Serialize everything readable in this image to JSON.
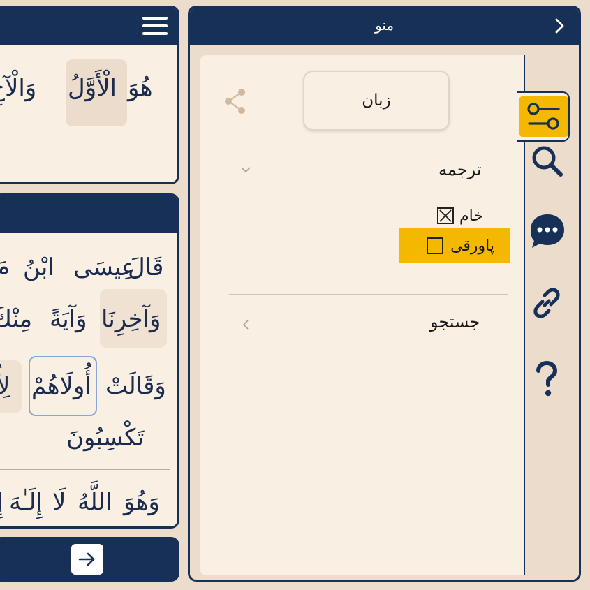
{
  "reader": {
    "top_panel": {
      "words": [
        "هُوَ",
        "الْأَوَّلُ",
        "وَالْآخِ"
      ]
    },
    "middle_panel": {
      "lines": [
        [
          "قَالَ",
          "عِيسَى",
          "ابْنُ",
          "مَ"
        ],
        [
          "وَآخِرِنَا",
          "وَآيَةً",
          "مِنْكَ"
        ],
        [
          "وَقَالَتْ",
          "أُولَاهُمْ",
          "لِأُ"
        ],
        [
          "تَكْسِبُونَ"
        ],
        [
          "وَهُوَ",
          "اللَّهُ",
          "لَا",
          "إِلَـٰهَ",
          "إِ"
        ]
      ]
    },
    "next_icon": "arrow-right-icon"
  },
  "menu": {
    "title": "منو",
    "back_icon": "chevron-right-icon",
    "language_button": "زبان",
    "share_icon": "share-icon",
    "translation": {
      "title": "ترجمه",
      "expanded": true,
      "options": [
        {
          "label": "خام",
          "checked": true,
          "highlighted": false
        },
        {
          "label": "پاورقی",
          "checked": false,
          "highlighted": true
        }
      ]
    },
    "search": {
      "title": "جستجو",
      "expanded": false
    },
    "rail": [
      {
        "name": "filter-icon",
        "active": true
      },
      {
        "name": "search-icon",
        "active": false
      },
      {
        "name": "chat-bubble-icon",
        "active": false
      },
      {
        "name": "link-icon",
        "active": false
      },
      {
        "name": "help-icon",
        "active": false
      }
    ]
  },
  "colors": {
    "navy": "#163058",
    "background": "#ecdccb",
    "panel": "#f9efe3",
    "accent_yellow": "#f5b800",
    "text": "#1b2b4d"
  }
}
